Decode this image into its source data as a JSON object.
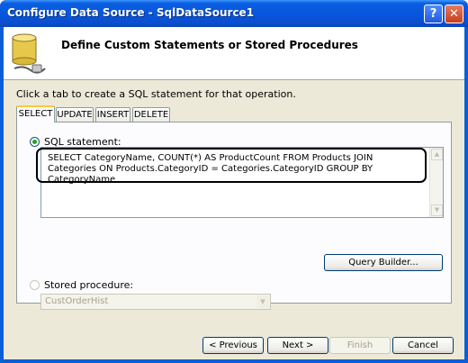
{
  "window": {
    "title": "Configure Data Source - SqlDataSource1",
    "help_glyph": "?",
    "close_glyph": "✕"
  },
  "header": {
    "title": "Define Custom Statements or Stored Procedures",
    "icon": "database-plug-icon"
  },
  "instruction": "Click a tab to create a SQL statement for that operation.",
  "tabs": [
    {
      "label": "SELECT",
      "active": true
    },
    {
      "label": "UPDATE",
      "active": false
    },
    {
      "label": "INSERT",
      "active": false
    },
    {
      "label": "DELETE",
      "active": false
    }
  ],
  "sql_statement": {
    "label": "SQL statement:",
    "selected": true,
    "value": "SELECT CategoryName, COUNT(*) AS ProductCount FROM Products JOIN Categories ON Products.CategoryID = Categories.CategoryID GROUP BY CategoryName"
  },
  "query_builder_label": "Query Builder...",
  "stored_procedure": {
    "label": "Stored procedure:",
    "selected": false,
    "value": "CustOrderHist"
  },
  "footer": {
    "previous_label": "< Previous",
    "next_label": "Next >",
    "finish_label": "Finish",
    "cancel_label": "Cancel"
  },
  "colors": {
    "titlebar": "#0a5fd8",
    "dialog_bg": "#ece9d8",
    "highlight": "#000000"
  }
}
